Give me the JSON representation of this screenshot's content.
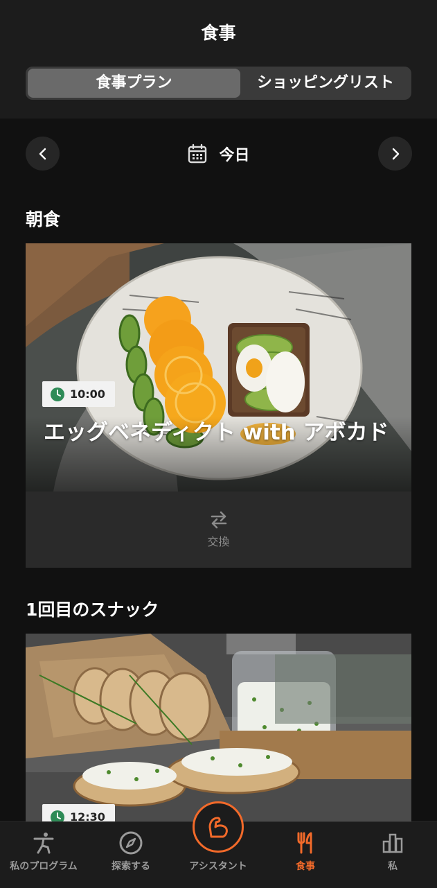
{
  "header": {
    "title": "食事",
    "tabs": [
      {
        "label": "食事プラン",
        "active": true
      },
      {
        "label": "ショッピングリスト",
        "active": false
      }
    ]
  },
  "date_nav": {
    "label": "今日",
    "prev_icon": "chevron-left-icon",
    "next_icon": "chevron-right-icon",
    "calendar_icon": "calendar-icon"
  },
  "meals": [
    {
      "section": "朝食",
      "time": "10:00",
      "title": "エッグベネディクト with アボカド",
      "swap_label": "交換"
    },
    {
      "section": "1回目のスナック",
      "time": "12:30"
    }
  ],
  "tabbar": {
    "items": [
      {
        "label": "私のプログラム",
        "icon": "exercise-figure-icon"
      },
      {
        "label": "探索する",
        "icon": "compass-icon"
      },
      {
        "label": "アシスタント",
        "icon": "flexed-arm-icon"
      },
      {
        "label": "食事",
        "icon": "fork-knife-icon",
        "active": true
      },
      {
        "label": "私",
        "icon": "bar-chart-icon"
      }
    ]
  },
  "colors": {
    "accent": "#f26a2a",
    "background": "#111111",
    "header": "#1c1c1c"
  }
}
